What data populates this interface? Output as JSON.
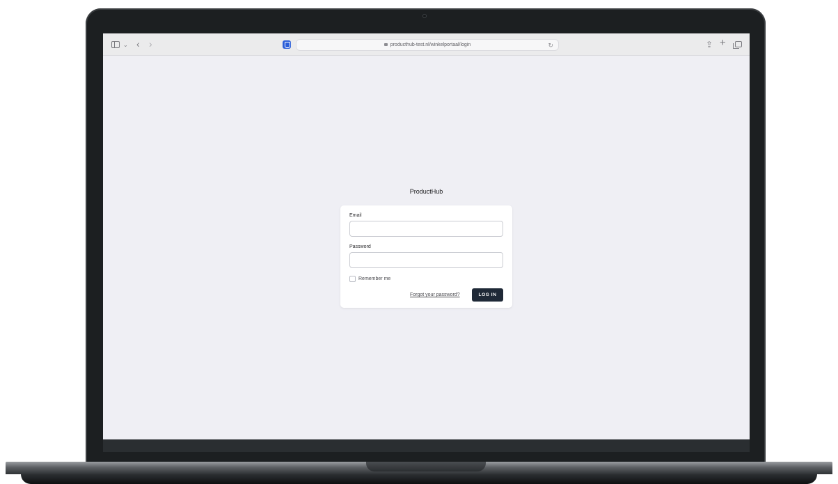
{
  "browser": {
    "url": "producthub-test.nl/winkelportaal/login",
    "icons": {
      "sidebar": "sidebar-icon",
      "tab_group": "chevron-down-icon",
      "back": "chevron-left-icon",
      "forward": "chevron-right-icon",
      "extension": "bitwarden-shield-icon",
      "lock": "lock-icon",
      "reload": "reload-icon",
      "share": "share-icon",
      "new_tab": "plus-icon",
      "tab_overview": "tabs-icon"
    }
  },
  "app": {
    "title": "ProductHub"
  },
  "login_form": {
    "email_label": "Email",
    "email_value": "",
    "password_label": "Password",
    "password_value": "",
    "remember_label": "Remember me",
    "remember_checked": false,
    "forgot_link": "Forgot your password?",
    "submit_label": "LOG IN"
  },
  "colors": {
    "page_background": "#efeff4",
    "button_background": "#1f2937",
    "bezel": "#1c1f21"
  }
}
